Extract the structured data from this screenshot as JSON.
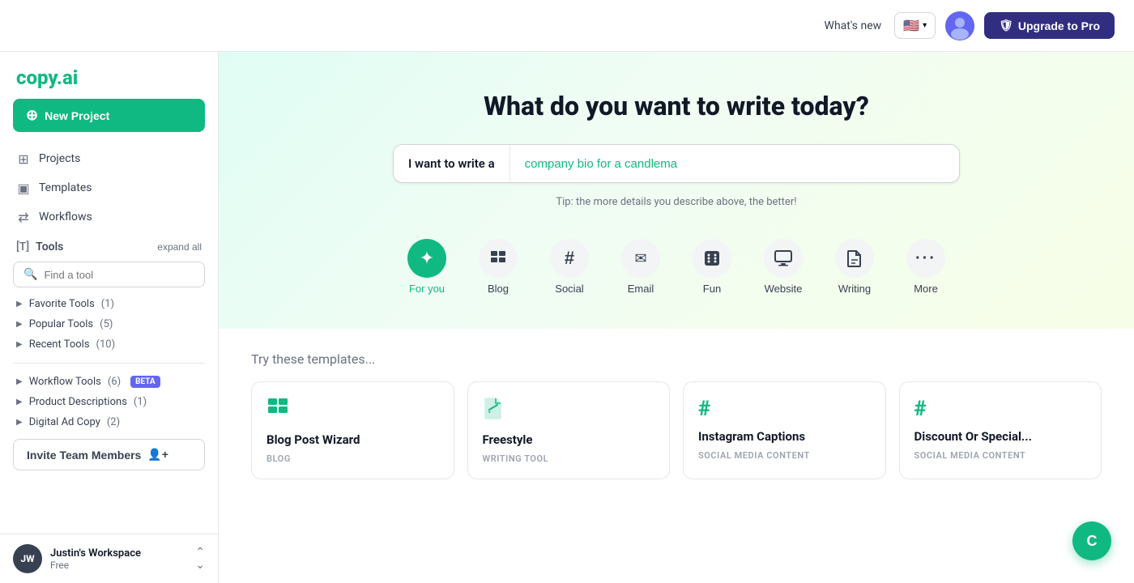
{
  "header": {
    "whats_new": "What's new",
    "lang_code": "🇺🇸",
    "upgrade_label": "Upgrade to Pro",
    "upgrade_icon": "✓"
  },
  "logo": {
    "text_main": "copy",
    "text_dot": ".",
    "text_ai": "ai"
  },
  "sidebar": {
    "new_project_label": "New Project",
    "nav": [
      {
        "id": "projects",
        "label": "Projects",
        "icon": "⊞"
      },
      {
        "id": "templates",
        "label": "Templates",
        "icon": "▣"
      },
      {
        "id": "workflows",
        "label": "Workflows",
        "icon": "⇄"
      }
    ],
    "tools_section": {
      "label": "Tools",
      "expand_label": "expand all",
      "search_placeholder": "Find a tool",
      "categories": [
        {
          "id": "favorite",
          "label": "Favorite Tools",
          "count": "(1)"
        },
        {
          "id": "popular",
          "label": "Popular Tools",
          "count": "(5)"
        },
        {
          "id": "recent",
          "label": "Recent Tools",
          "count": "(10)"
        }
      ]
    },
    "workflow_tools": {
      "label": "Workflow Tools",
      "count": "(6)",
      "beta": "BETA"
    },
    "product_descriptions": {
      "label": "Product Descriptions",
      "count": "(1)"
    },
    "digital_ad_copy": {
      "label": "Digital Ad Copy",
      "count": "(2)"
    },
    "invite_label": "Invite Team Members",
    "workspace": {
      "initials": "JW",
      "name": "Justin's Workspace",
      "plan": "Free"
    }
  },
  "hero": {
    "title": "What do you want to write today?",
    "input_label": "I want to write a",
    "input_value": "company bio for a candlema",
    "tip": "Tip: the more details you describe above, the better!"
  },
  "tool_tabs": [
    {
      "id": "for_you",
      "label": "For you",
      "icon": "✦",
      "active": true
    },
    {
      "id": "blog",
      "label": "Blog",
      "icon": "▦"
    },
    {
      "id": "social",
      "label": "Social",
      "icon": "#"
    },
    {
      "id": "email",
      "label": "Email",
      "icon": "✉"
    },
    {
      "id": "fun",
      "label": "Fun",
      "icon": "⚅"
    },
    {
      "id": "website",
      "label": "Website",
      "icon": "▭"
    },
    {
      "id": "writing",
      "label": "Writing",
      "icon": "📄"
    },
    {
      "id": "more",
      "label": "More",
      "icon": "···"
    }
  ],
  "templates": {
    "title": "Try these templates...",
    "cards": [
      {
        "id": "blog_wizard",
        "name": "Blog Post Wizard",
        "category": "BLOG",
        "icon": "▦",
        "icon_color": "#10b981"
      },
      {
        "id": "freestyle",
        "name": "Freestyle",
        "category": "WRITING TOOL",
        "icon": "📝",
        "icon_color": "#10b981"
      },
      {
        "id": "instagram",
        "name": "Instagram Captions",
        "category": "SOCIAL MEDIA CONTENT",
        "icon": "#",
        "icon_color": "#10b981"
      },
      {
        "id": "discount",
        "name": "Discount Or Special...",
        "category": "SOCIAL MEDIA CONTENT",
        "icon": "#",
        "icon_color": "#10b981"
      }
    ]
  },
  "fab": {
    "label": "C"
  }
}
